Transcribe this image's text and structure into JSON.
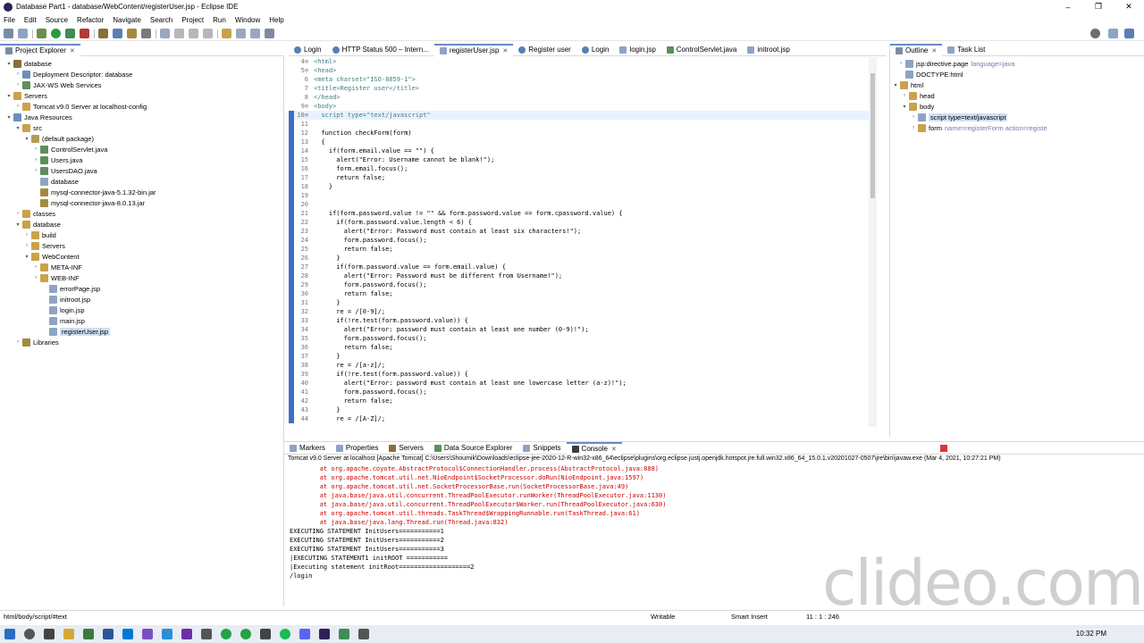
{
  "window": {
    "title": "Database Part1 - database/WebContent/registerUser.jsp - Eclipse IDE",
    "controls": [
      "–",
      "❐",
      "✕"
    ]
  },
  "menu": [
    "File",
    "Edit",
    "Source",
    "Refactor",
    "Navigate",
    "Search",
    "Project",
    "Run",
    "Window",
    "Help"
  ],
  "explorer": {
    "title": "Project Explorer",
    "items": [
      {
        "label": "database"
      },
      {
        "label": "Deployment Descriptor: database"
      },
      {
        "label": "JAX-WS Web Services"
      },
      {
        "label": "Servers"
      },
      {
        "label": "Tomcat v9.0 Server at localhost-config"
      },
      {
        "label": "Java Resources"
      },
      {
        "label": "src"
      },
      {
        "label": "(default package)"
      },
      {
        "label": "ControlServlet.java"
      },
      {
        "label": "Users.java"
      },
      {
        "label": "UsersDAO.java"
      },
      {
        "label": "database"
      },
      {
        "label": "mysql-connector-java-5.1.32-bin.jar"
      },
      {
        "label": "mysql-connector-java-8.0.13.jar"
      },
      {
        "label": "classes"
      },
      {
        "label": "database"
      },
      {
        "label": "build"
      },
      {
        "label": "Servers"
      },
      {
        "label": "WebContent"
      },
      {
        "label": "META-INF"
      },
      {
        "label": "WEB-INF"
      },
      {
        "label": "errorPage.jsp"
      },
      {
        "label": "initroot.jsp"
      },
      {
        "label": "login.jsp"
      },
      {
        "label": "main.jsp"
      },
      {
        "label": "registerUser.jsp"
      },
      {
        "label": "Libraries"
      }
    ]
  },
  "editor_tabs": [
    {
      "label": "Login"
    },
    {
      "label": "HTTP Status 500 – Intern..."
    },
    {
      "label": "registerUser.jsp"
    },
    {
      "label": "Register user"
    },
    {
      "label": "Login"
    },
    {
      "label": "login.jsp"
    },
    {
      "label": "ControlServlet.java"
    },
    {
      "label": "initroot.jsp"
    }
  ],
  "code": [
    {
      "ln": "4⊖",
      "text": "<html>"
    },
    {
      "ln": "5⊖",
      "text": "<head>"
    },
    {
      "ln": "6",
      "text": "<meta charset=\"ISO-8859-1\">"
    },
    {
      "ln": "7",
      "text": "<title>Register user</title>"
    },
    {
      "ln": "8",
      "text": "</head>"
    },
    {
      "ln": "9⊖",
      "text": "<body>"
    },
    {
      "ln": "10⊖",
      "text": "  script type=\"text/javascript\""
    },
    {
      "ln": "11",
      "text": ""
    },
    {
      "ln": "12",
      "text": "  function checkForm(form)"
    },
    {
      "ln": "13",
      "text": "  {"
    },
    {
      "ln": "14",
      "text": "    if(form.email.value == \"\") {"
    },
    {
      "ln": "15",
      "text": "      alert(\"Error: Username cannot be blank!\");"
    },
    {
      "ln": "16",
      "text": "      form.email.focus();"
    },
    {
      "ln": "17",
      "text": "      return false;"
    },
    {
      "ln": "18",
      "text": "    }"
    },
    {
      "ln": "19",
      "text": ""
    },
    {
      "ln": "20",
      "text": ""
    },
    {
      "ln": "21",
      "text": "    if(form.password.value != \"\" && form.password.value == form.cpassword.value) {"
    },
    {
      "ln": "22",
      "text": "      if(form.password.value.length < 6) {"
    },
    {
      "ln": "23",
      "text": "        alert(\"Error: Password must contain at least six characters!\");"
    },
    {
      "ln": "24",
      "text": "        form.password.focus();"
    },
    {
      "ln": "25",
      "text": "        return false;"
    },
    {
      "ln": "26",
      "text": "      }"
    },
    {
      "ln": "27",
      "text": "      if(form.password.value == form.email.value) {"
    },
    {
      "ln": "28",
      "text": "        alert(\"Error: Password must be different from Username!\");"
    },
    {
      "ln": "29",
      "text": "        form.password.focus();"
    },
    {
      "ln": "30",
      "text": "        return false;"
    },
    {
      "ln": "31",
      "text": "      }"
    },
    {
      "ln": "32",
      "text": "      re = /[0-9]/;"
    },
    {
      "ln": "33",
      "text": "      if(!re.test(form.password.value)) {"
    },
    {
      "ln": "34",
      "text": "        alert(\"Error: password must contain at least one number (0-9)!\");"
    },
    {
      "ln": "35",
      "text": "        form.password.focus();"
    },
    {
      "ln": "36",
      "text": "        return false;"
    },
    {
      "ln": "37",
      "text": "      }"
    },
    {
      "ln": "38",
      "text": "      re = /[a-z]/;"
    },
    {
      "ln": "39",
      "text": "      if(!re.test(form.password.value)) {"
    },
    {
      "ln": "40",
      "text": "        alert(\"Error: password must contain at least one lowercase letter (a-z)!\");"
    },
    {
      "ln": "41",
      "text": "        form.password.focus();"
    },
    {
      "ln": "42",
      "text": "        return false;"
    },
    {
      "ln": "43",
      "text": "      }"
    },
    {
      "ln": "44",
      "text": "      re = /[A-Z]/;"
    }
  ],
  "outline": {
    "tabs": [
      {
        "label": "Outline"
      },
      {
        "label": "Task List"
      }
    ],
    "items": [
      {
        "label": "jsp:directive.page",
        "extra": "language=java"
      },
      {
        "label": "DOCTYPE:html",
        "extra": ""
      },
      {
        "label": "html",
        "extra": ""
      },
      {
        "label": "head",
        "extra": ""
      },
      {
        "label": "body",
        "extra": ""
      },
      {
        "label": "script type=text/javascript",
        "extra": ""
      },
      {
        "label": "form",
        "extra": "name=registerForm action=registe"
      }
    ]
  },
  "console": {
    "tabs": [
      {
        "label": "Markers"
      },
      {
        "label": "Properties"
      },
      {
        "label": "Servers"
      },
      {
        "label": "Data Source Explorer"
      },
      {
        "label": "Snippets"
      },
      {
        "label": "Console"
      }
    ],
    "title": "Tomcat v9.0 Server at localhost [Apache Tomcat] C:\\Users\\Shoumik\\Downloads\\eclipse-jee-2020-12-R-win32-x86_64\\eclipse\\plugins\\org.eclipse.justj.openjdk.hotspot.jre.full.win32.x86_64_15.0.1.v20201027-0507\\jre\\bin\\javaw.exe (Mar 4, 2021, 10:27:21 PM)",
    "lines": [
      "        at org.apache.coyote.AbstractProtocol$ConnectionHandler.process(AbstractProtocol.java:888)",
      "        at org.apache.tomcat.util.net.NioEndpoint$SocketProcessor.doRun(NioEndpoint.java:1597)",
      "        at org.apache.tomcat.util.net.SocketProcessorBase.run(SocketProcessorBase.java:49)",
      "        at java.base/java.util.concurrent.ThreadPoolExecutor.runWorker(ThreadPoolExecutor.java:1130)",
      "        at java.base/java.util.concurrent.ThreadPoolExecutor$Worker.run(ThreadPoolExecutor.java:630)",
      "        at org.apache.tomcat.util.threads.TaskThread$WrappingRunnable.run(TaskThread.java:61)",
      "        at java.base/java.lang.Thread.run(Thread.java:832)",
      "EXECUTING STATEMENT InitUsers===========1",
      "EXECUTING STATEMENT InitUsers===========2",
      "EXECUTING STATEMENT InitUsers===========3",
      "|EXECUTING STATEMENT1 initROOT ===========",
      "|Executing statement initRoot===================2",
      "/login"
    ]
  },
  "status": {
    "path": "html/body/script/#text",
    "mode": "Writable",
    "insert": "Smart Insert",
    "position": "11 : 1 : 246"
  },
  "taskbar": {
    "time": "10:32 PM"
  },
  "watermark": "clideo.com",
  "colors": {
    "accent": "#3e6fc7",
    "selection": "#cfe0f5",
    "current_line": "#e8f2fe"
  }
}
